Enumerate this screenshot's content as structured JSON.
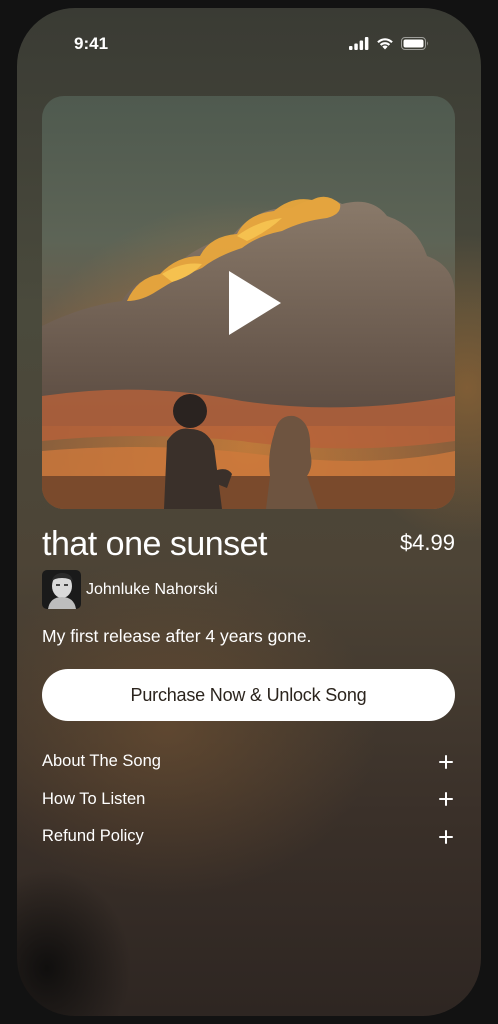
{
  "status_bar": {
    "time": "9:41",
    "icons": [
      "cellular-signal-icon",
      "wifi-icon",
      "battery-icon"
    ]
  },
  "hero": {
    "image": "sunset-couple-photo",
    "play_icon": "play-icon"
  },
  "song": {
    "title": "that one sunset",
    "price": "$4.99",
    "artist": "Johnluke Nahorski",
    "description": "My first release after 4 years gone."
  },
  "purchase": {
    "label": "Purchase Now & Unlock Song"
  },
  "accordion": {
    "items": [
      {
        "label": "About The Song",
        "icon": "plus-icon"
      },
      {
        "label": "How To Listen",
        "icon": "plus-icon"
      },
      {
        "label": "Refund Policy",
        "icon": "plus-icon"
      }
    ]
  },
  "colors": {
    "button_bg": "#ffffff",
    "button_text": "#2b241d",
    "text": "#ffffff",
    "page_bg": "#121212"
  }
}
